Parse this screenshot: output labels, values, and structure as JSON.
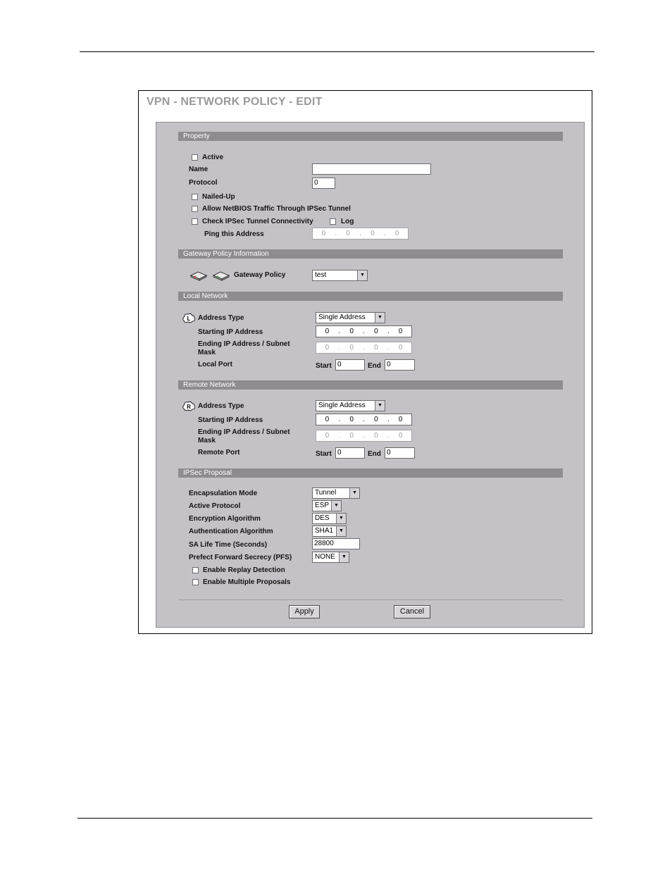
{
  "page": {
    "title": "VPN - NETWORK POLICY - EDIT"
  },
  "sections": {
    "property": "Property",
    "gateway": "Gateway Policy Information",
    "local": "Local Network",
    "remote": "Remote Network",
    "ipsec": "IPSec Proposal"
  },
  "property": {
    "active_label": "Active",
    "name_label": "Name",
    "name_value": "",
    "protocol_label": "Protocol",
    "protocol_value": "0",
    "nailed_up_label": "Nailed-Up",
    "netbios_label": "Allow NetBIOS Traffic Through IPSec Tunnel",
    "check_conn_label": "Check IPSec Tunnel Connectivity",
    "log_label": "Log",
    "ping_label": "Ping this Address",
    "ping_ip": [
      "0",
      "0",
      "0",
      "0"
    ]
  },
  "gateway": {
    "policy_label": "Gateway Policy",
    "policy_value": "test"
  },
  "local": {
    "address_type_label": "Address Type",
    "address_type_value": "Single Address",
    "start_ip_label": "Starting IP Address",
    "start_ip": [
      "0",
      "0",
      "0",
      "0"
    ],
    "end_ip_label_1": "Ending IP Address / Subnet",
    "end_ip_label_2": "Mask",
    "end_ip": [
      "0",
      "0",
      "0",
      "0"
    ],
    "port_label": "Local Port",
    "start_label": "Start",
    "start_value": "0",
    "end_label": "End",
    "end_value": "0"
  },
  "remote": {
    "address_type_label": "Address Type",
    "address_type_value": "Single Address",
    "start_ip_label": "Starting IP Address",
    "start_ip": [
      "0",
      "0",
      "0",
      "0"
    ],
    "end_ip_label_1": "Ending IP Address / Subnet",
    "end_ip_label_2": "Mask",
    "end_ip": [
      "0",
      "0",
      "0",
      "0"
    ],
    "port_label": "Remote Port",
    "start_label": "Start",
    "start_value": "0",
    "end_label": "End",
    "end_value": "0"
  },
  "ipsec": {
    "encap_label": "Encapsulation Mode",
    "encap_value": "Tunnel",
    "protocol_label": "Active Protocol",
    "protocol_value": "ESP",
    "encryption_label": "Encryption Algorithm",
    "encryption_value": "DES",
    "auth_label": "Authentication Algorithm",
    "auth_value": "SHA1",
    "lifetime_label": "SA Life Time (Seconds)",
    "lifetime_value": "28800",
    "pfs_label": "Prefect Forward Secrecy (PFS)",
    "pfs_value": "NONE",
    "replay_label": "Enable Replay Detection",
    "multiple_label": "Enable Multiple Proposals"
  },
  "buttons": {
    "apply": "Apply",
    "cancel": "Cancel"
  },
  "icons": {
    "gateway": "vpn-gateway-icon",
    "local": "local-network-icon",
    "remote": "remote-network-icon"
  }
}
